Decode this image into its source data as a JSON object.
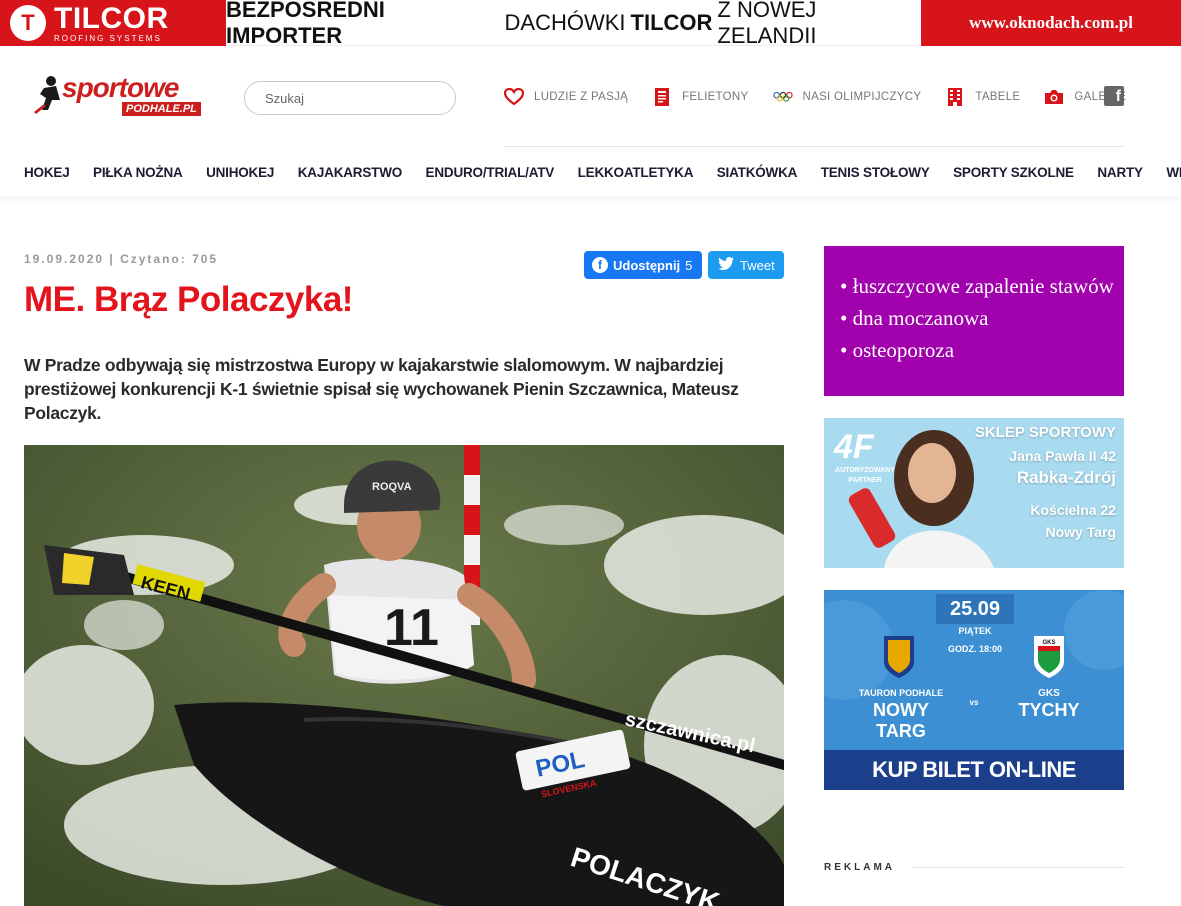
{
  "top_banner": {
    "left_brand": "TILCOR",
    "left_sub": "ROOFING SYSTEMS",
    "middle_parts": [
      "BEZPOŚREDNI IMPORTER",
      "DACHÓWKI",
      "TILCOR",
      "Z NOWEJ ZELANDII"
    ],
    "right_url": "www.oknodach.com.pl"
  },
  "header": {
    "logo_text": "sportowe",
    "logo_sub": "PODHALE.PL",
    "search_placeholder": "Szukaj",
    "topnav": [
      {
        "label": "LUDZIE Z PASJĄ",
        "icon": "heart-icon"
      },
      {
        "label": "FELIETONY",
        "icon": "newspaper-icon"
      },
      {
        "label": "NASI OLIMPIJCZYCY",
        "icon": "olympic-rings-icon"
      },
      {
        "label": "TABELE",
        "icon": "building-icon"
      },
      {
        "label": "GALERIE",
        "icon": "camera-icon"
      }
    ],
    "mainnav": [
      "HOKEJ",
      "PIŁKA NOŻNA",
      "UNIHOKEJ",
      "KAJAKARSTWO",
      "ENDURO/TRIAL/ATV",
      "LEKKOATLETYKA",
      "SIATKÓWKA",
      "TENIS STOŁOWY",
      "SPORTY SZKOLNE",
      "NARTY",
      "WIĘCEJ"
    ]
  },
  "article": {
    "meta": "19.09.2020 | Czytano: 705",
    "share_fb_label": "Udostępnij",
    "share_fb_count": "5",
    "share_tw_label": "Tweet",
    "title": "ME. Brąz Polaczyka!",
    "lead": "W Pradze odbywają się mistrzostwa Europy w kajakarstwie slalomowym. W najbardziej prestiżowej konkurencji K-1 świetnie spisał się wychowanek Pienin Szczawnica, Mateusz Polaczyk.",
    "photo": {
      "bib": "11",
      "helmet_brand": "ROQVA",
      "paddle_brand": "KEEN",
      "boat_sponsor": "szczawnica.pl",
      "boat_country": "POL",
      "boat_sub": "SLOVENSKA",
      "boat_name": "POLACZYK"
    }
  },
  "sidebar": {
    "ad_purple_items": [
      "łuszczycowe zapalenie stawów",
      "dna moczanowa",
      "osteoporoza"
    ],
    "ad_4f": {
      "logo": "4F",
      "auth": "AUTORYZOWANY PARTNER",
      "line1": "SKLEP SPORTOWY",
      "line2": "Jana Pawła II 42",
      "line3": "Rabka-Zdrój",
      "line4": "Kościelna 22",
      "line5": "Nowy Targ"
    },
    "ad_match": {
      "date": "25.09",
      "day": "PIĄTEK",
      "time": "GODZ. 18:00",
      "home_top": "TAURON PODHALE",
      "home_name": "NOWY TARG",
      "vs": "vs",
      "away_top": "GKS",
      "away_name": "TYCHY",
      "away_badge": "GKS",
      "cta": "KUP BILET ON-LINE"
    },
    "reklama": "REKLAMA"
  }
}
